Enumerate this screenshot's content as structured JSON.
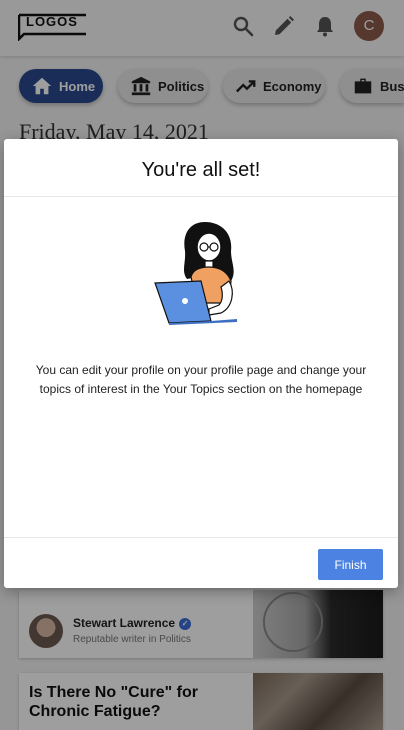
{
  "header": {
    "logo_text": "LOGOS",
    "avatar_initial": "C"
  },
  "topics": [
    {
      "label": "Home",
      "icon": "home-icon",
      "active": true
    },
    {
      "label": "Politics",
      "icon": "bank-icon",
      "active": false
    },
    {
      "label": "Economy",
      "icon": "trending-up-icon",
      "active": false
    },
    {
      "label": "Busi",
      "icon": "briefcase-icon",
      "active": false
    }
  ],
  "date_heading": "Friday, May 14, 2021",
  "feed": {
    "author_card": {
      "author_name": "Stewart Lawrence",
      "author_subtitle": "Reputable writer in Politics"
    },
    "article_card": {
      "headline": "Is There No \"Cure\" for Chronic Fatigue?"
    }
  },
  "modal": {
    "title": "You're all set!",
    "message": "You can edit your profile on your profile page and change your topics of interest in the Your Topics section on the homepage",
    "finish_label": "Finish"
  },
  "colors": {
    "accent": "#4c82e2",
    "home_pill": "#2a4a8f",
    "avatar": "#8d5b4c",
    "illustration_shirt": "#f0a060",
    "illustration_laptop": "#5b8fe0"
  }
}
